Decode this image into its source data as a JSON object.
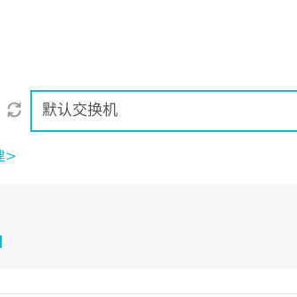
{
  "switch_selector": {
    "selected_value": "默认交换机",
    "refresh_icon": "refresh-icon"
  },
  "suggestion": {
    "link_text": "建>"
  },
  "colors": {
    "accent": "#1bb5cc",
    "panel_bg": "#f6f7f9",
    "text": "#555555",
    "icon": "#9a9a9a"
  }
}
